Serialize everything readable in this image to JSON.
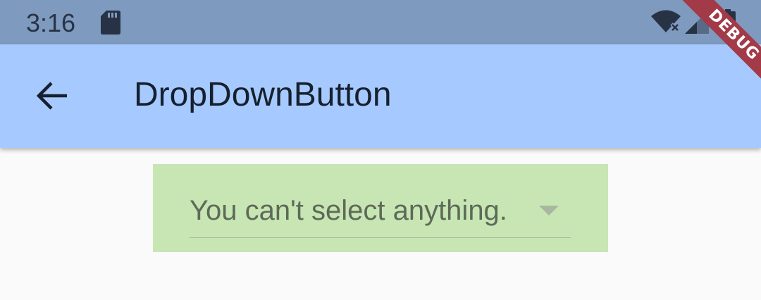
{
  "status_bar": {
    "time": "3:16",
    "icons": [
      "sd-card-icon",
      "wifi-off-icon",
      "signal-icon",
      "battery-charging-icon"
    ],
    "background": "#7f9abf"
  },
  "app_bar": {
    "title": "DropDownButton",
    "back_icon": "arrow-back-icon",
    "background": "#a6caff"
  },
  "debug_banner": {
    "label": "DEBUG",
    "color": "#a33a48"
  },
  "dropdown": {
    "hint": "You can't select anything.",
    "arrow_icon": "dropdown-arrow-icon",
    "disabled": true,
    "container_background": "#c8e5b4"
  }
}
